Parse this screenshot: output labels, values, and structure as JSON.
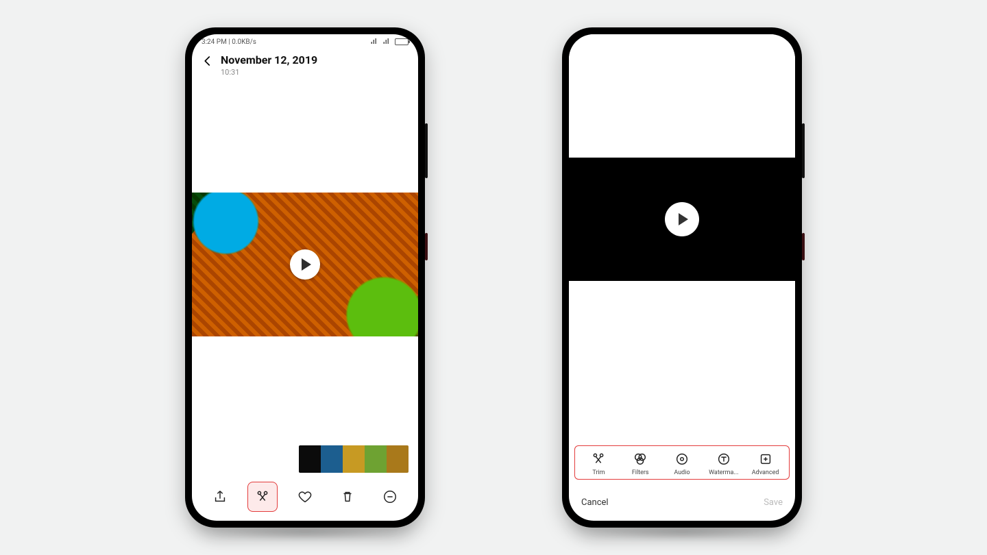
{
  "phone1": {
    "status": {
      "time": "3:24 PM",
      "net": "0.0KB/s"
    },
    "header": {
      "date": "November 12, 2019",
      "time": "10:31"
    },
    "actions": {
      "share": "Share",
      "edit": "Edit",
      "favorite": "Favorite",
      "delete": "Delete",
      "more": "More"
    }
  },
  "phone2": {
    "tools": {
      "trim": "Trim",
      "filters": "Filters",
      "audio": "Audio",
      "watermark": "Waterma...",
      "advanced": "Advanced"
    },
    "confirm": {
      "cancel": "Cancel",
      "save": "Save"
    }
  }
}
